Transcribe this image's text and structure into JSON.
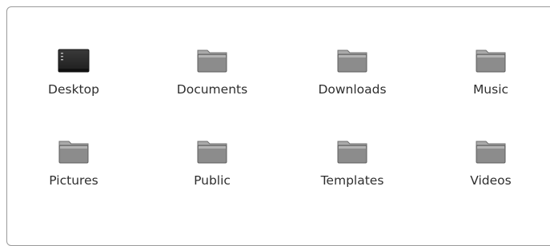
{
  "folders": [
    {
      "label": "Desktop",
      "icon": "desktop-icon"
    },
    {
      "label": "Documents",
      "icon": "folder-icon"
    },
    {
      "label": "Downloads",
      "icon": "folder-icon"
    },
    {
      "label": "Music",
      "icon": "folder-icon"
    },
    {
      "label": "Pictures",
      "icon": "folder-icon"
    },
    {
      "label": "Public",
      "icon": "folder-icon"
    },
    {
      "label": "Templates",
      "icon": "folder-icon"
    },
    {
      "label": "Videos",
      "icon": "folder-icon"
    }
  ],
  "colors": {
    "text": "#2e2e2e",
    "folder_body": "#8c8c8c",
    "folder_tab": "#a9a9a9",
    "desktop_dark": "#2b2b2b"
  }
}
